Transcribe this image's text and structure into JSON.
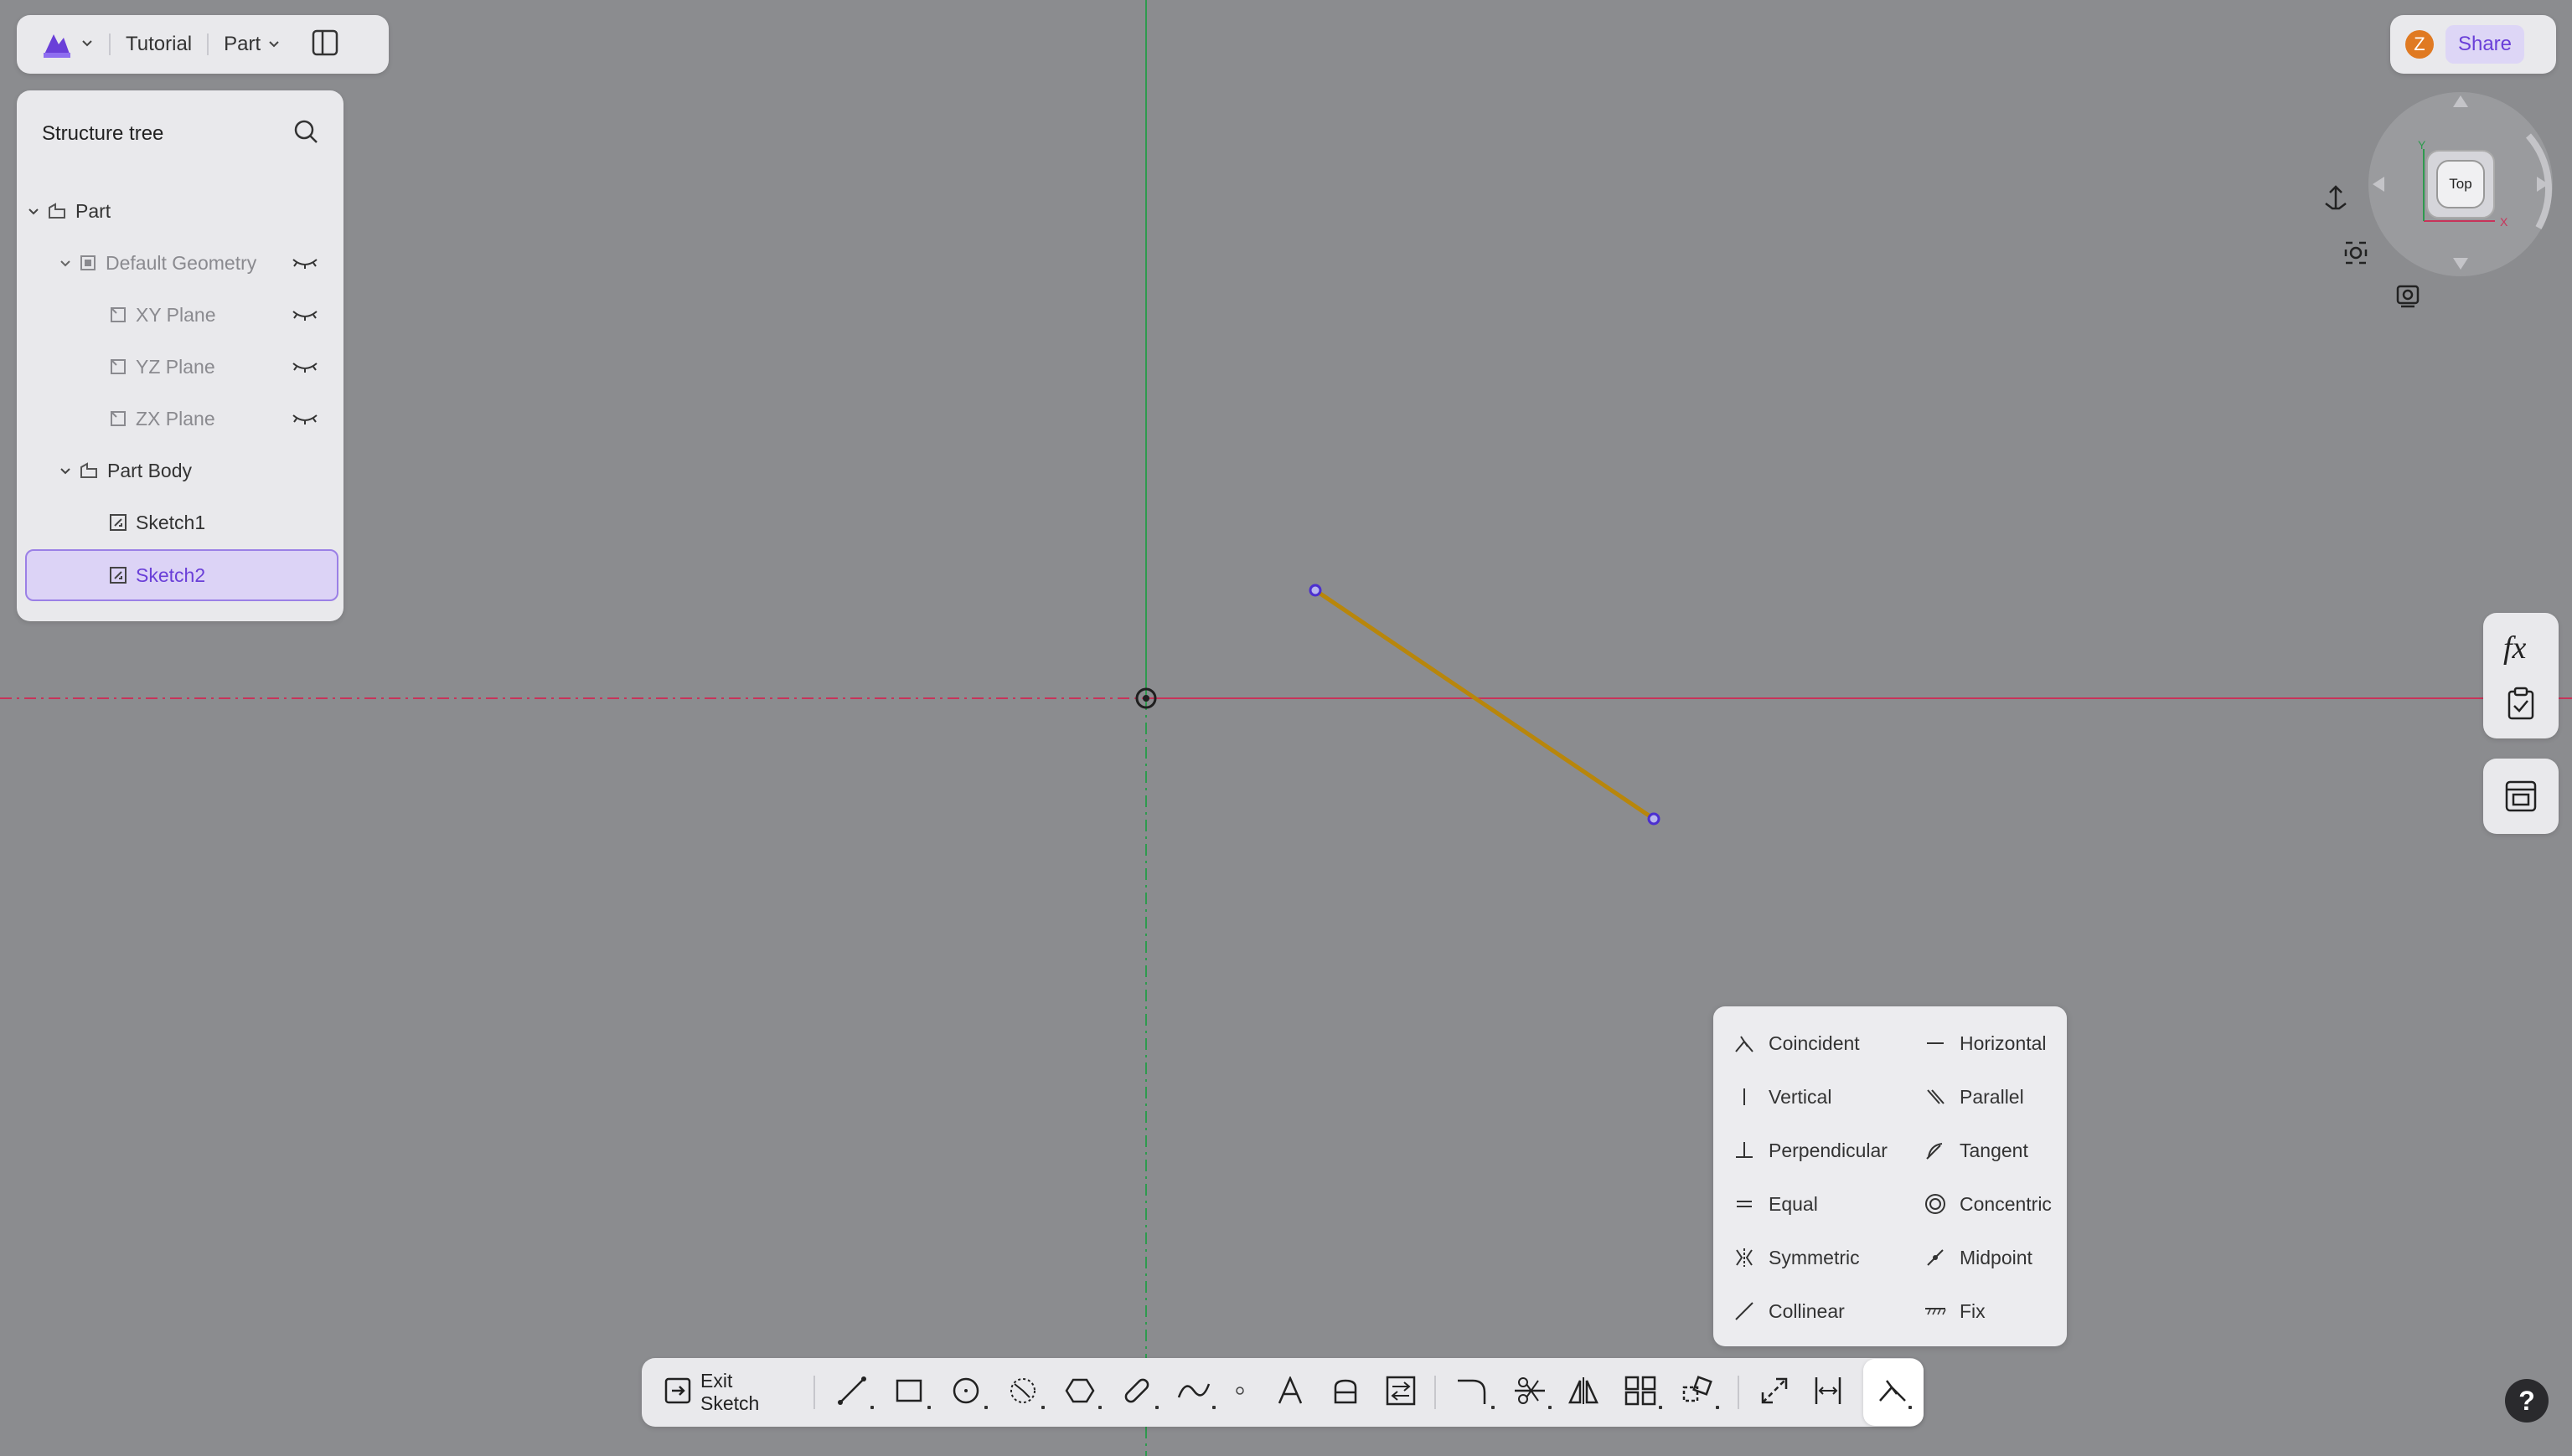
{
  "header": {
    "project": "Tutorial",
    "part_menu": "Part",
    "share_label": "Share",
    "avatar_initial": "Z"
  },
  "tree": {
    "title": "Structure tree",
    "items": [
      {
        "label": "Part"
      },
      {
        "label": "Default Geometry"
      },
      {
        "label": "XY Plane"
      },
      {
        "label": "YZ Plane"
      },
      {
        "label": "ZX Plane"
      },
      {
        "label": "Part Body"
      },
      {
        "label": "Sketch1"
      },
      {
        "label": "Sketch2"
      }
    ]
  },
  "viewcube": {
    "face": "Top",
    "axis_x": "X",
    "axis_y": "Y"
  },
  "constraints": [
    {
      "label": "Coincident",
      "icon": "coincident-icon"
    },
    {
      "label": "Horizontal",
      "icon": "horizontal-icon"
    },
    {
      "label": "Vertical",
      "icon": "vertical-icon"
    },
    {
      "label": "Parallel",
      "icon": "parallel-icon"
    },
    {
      "label": "Perpendicular",
      "icon": "perpendicular-icon"
    },
    {
      "label": "Tangent",
      "icon": "tangent-icon"
    },
    {
      "label": "Equal",
      "icon": "equal-icon"
    },
    {
      "label": "Concentric",
      "icon": "concentric-icon"
    },
    {
      "label": "Symmetric",
      "icon": "symmetric-icon"
    },
    {
      "label": "Midpoint",
      "icon": "midpoint-icon"
    },
    {
      "label": "Collinear",
      "icon": "collinear-icon"
    },
    {
      "label": "Fix",
      "icon": "fix-icon"
    }
  ],
  "toolbar": {
    "exit_label": "Exit Sketch"
  },
  "right_panel": {
    "fx_label": "fx"
  },
  "help_label": "?",
  "colors": {
    "canvas": "#8b8c8f",
    "accent": "#6a3fd8",
    "line": "#b8860b",
    "x_axis": "#c8345a",
    "y_axis": "#2e9a4e"
  }
}
